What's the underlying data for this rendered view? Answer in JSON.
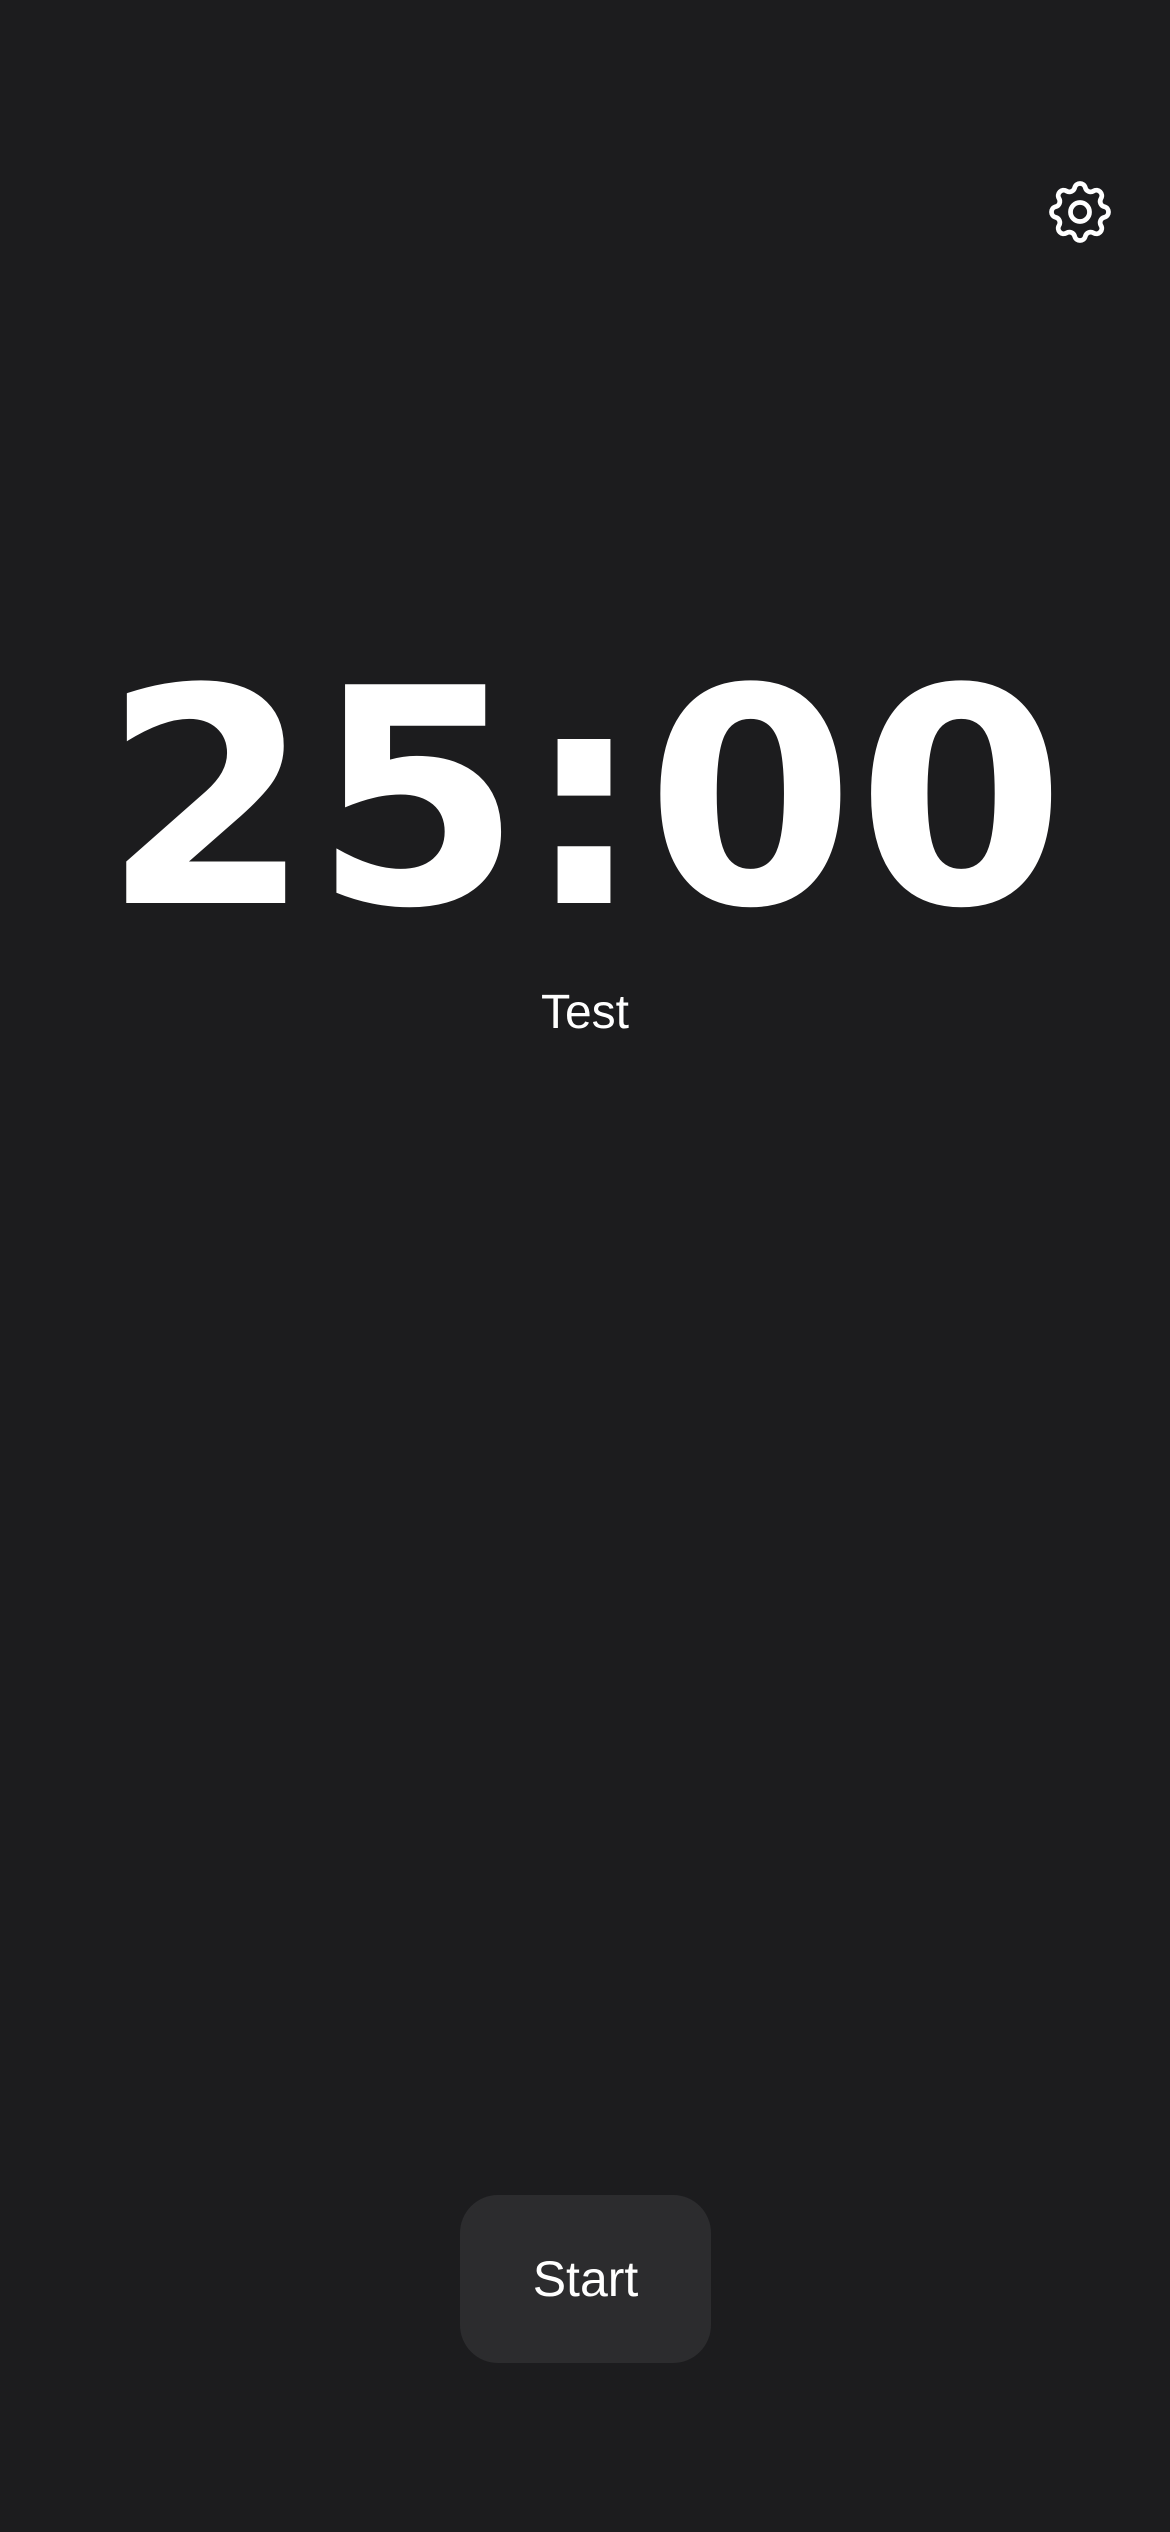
{
  "header": {
    "settings_icon": "gear-icon"
  },
  "timer": {
    "display": "25:00",
    "label": "Test"
  },
  "controls": {
    "start_label": "Start"
  },
  "colors": {
    "background": "#1c1c1e",
    "button_background": "#2c2c2e",
    "text": "#ffffff"
  }
}
